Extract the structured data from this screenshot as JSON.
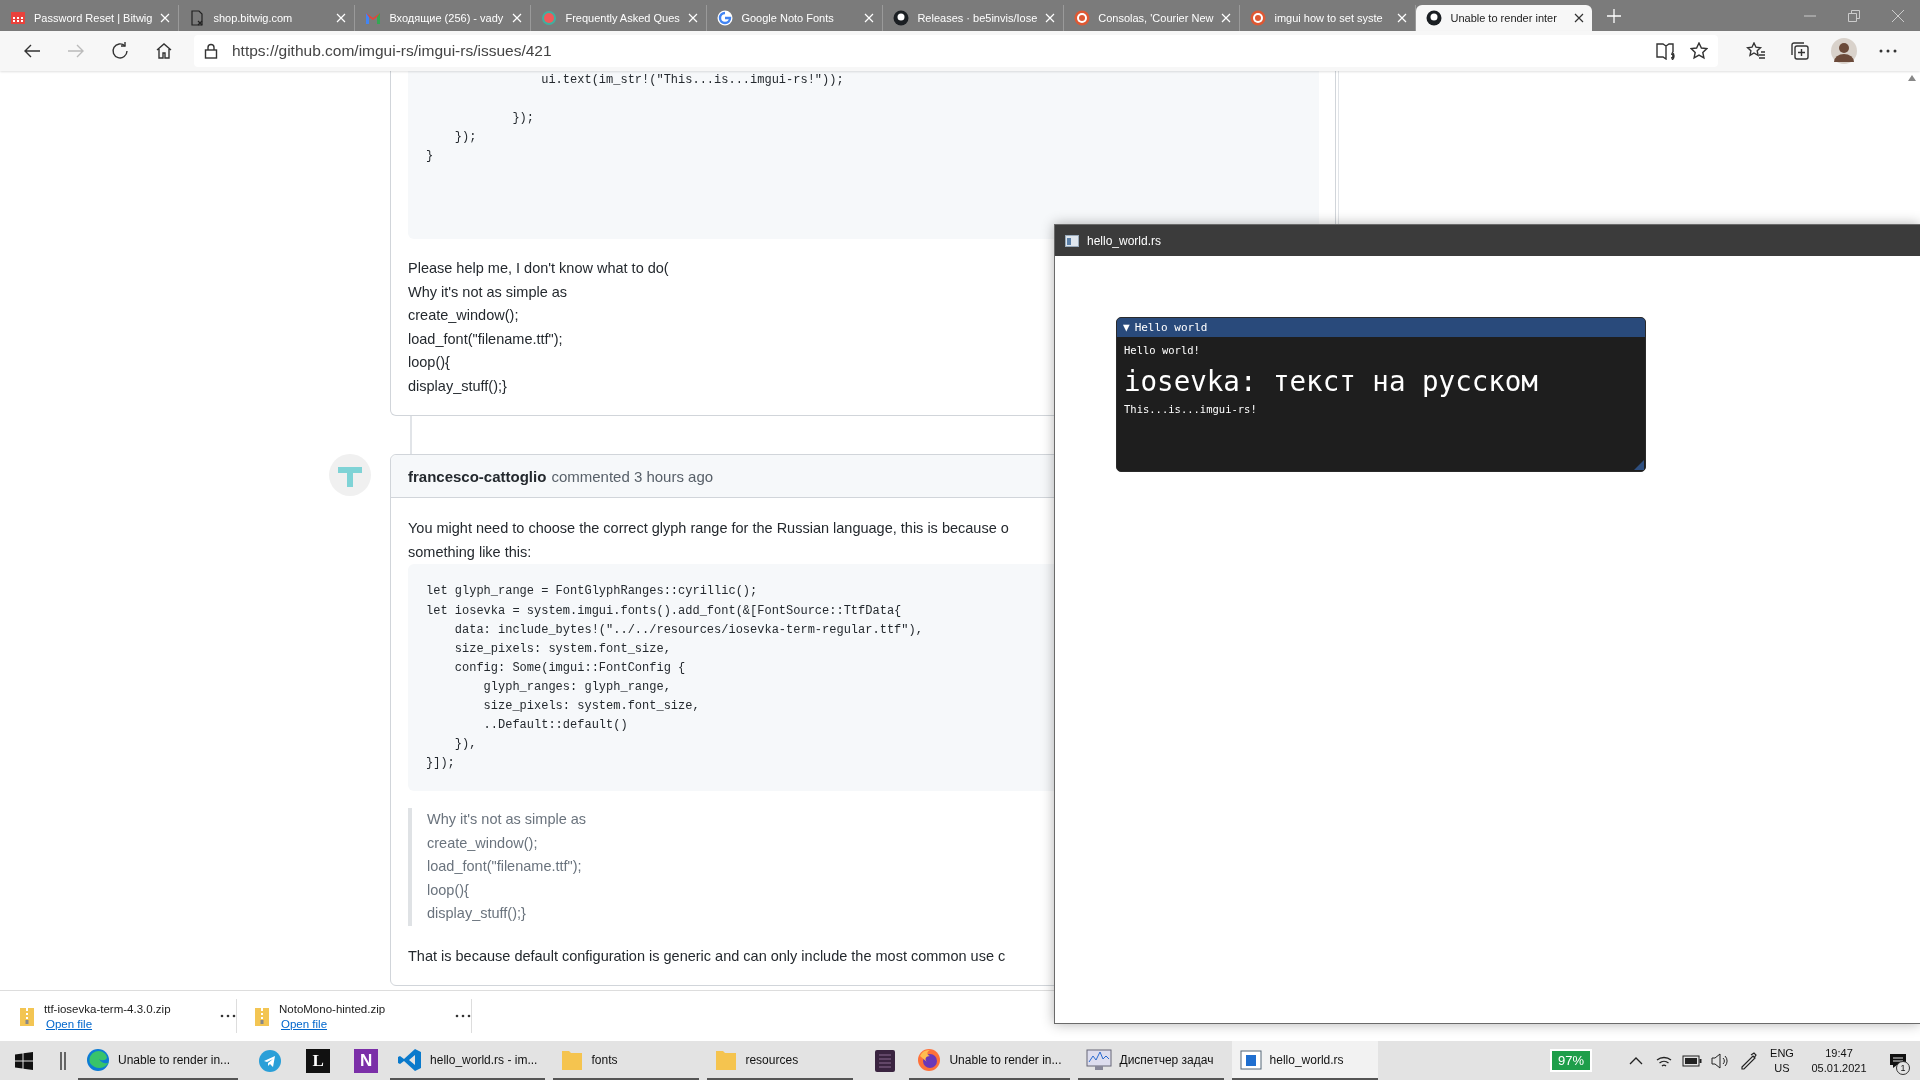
{
  "browser": {
    "tabs": [
      {
        "title": "Password Reset | Bitwig",
        "selected": false
      },
      {
        "title": "shop.bitwig.com",
        "selected": false
      },
      {
        "title": "Входящие (256) - vady",
        "selected": false
      },
      {
        "title": "Frequently Asked Ques",
        "selected": false
      },
      {
        "title": "Google Noto Fonts",
        "selected": false
      },
      {
        "title": "Releases · be5invis/Iose",
        "selected": false
      },
      {
        "title": "Consolas, 'Courier New",
        "selected": false
      },
      {
        "title": "imgui how to set syste",
        "selected": false
      },
      {
        "title": "Unable to render inter",
        "selected": true
      }
    ],
    "address": "https://github.com/imgui-rs/imgui-rs/issues/421"
  },
  "issue": {
    "comments": [
      {
        "blocks": [
          {
            "kind": "code",
            "text": "                ui.text(im_str!(\"This...is...imgui-rs!\"));\n\n            });\n    });\n}"
          },
          {
            "kind": "text",
            "text": "Please help me, I don't know what to do(\nWhy it's not as simple as\ncreate_window();\nload_font(\"filename.ttf\");\nloop(){\ndisplay_stuff();}"
          }
        ]
      },
      {
        "author": "francesco-cattoglio",
        "meta": "commented 3 hours ago",
        "blocks": [
          {
            "kind": "text",
            "text": "You might need to choose the correct glyph range for the Russian language, this is because o\nsomething like this:"
          },
          {
            "kind": "code",
            "text": "let glyph_range = FontGlyphRanges::cyrillic();\nlet iosevka = system.imgui.fonts().add_font(&[FontSource::TtfData{\n    data: include_bytes!(\"../../resources/iosevka-term-regular.ttf\"),\n    size_pixels: system.font_size,\n    config: Some(imgui::FontConfig {\n        glyph_ranges: glyph_range,\n        size_pixels: system.font_size,\n        ..Default::default()\n    }),\n}]);"
          },
          {
            "kind": "quote",
            "text": "Why it's not as simple as\ncreate_window();\nload_font(\"filename.ttf\");\nloop(){\ndisplay_stuff();}"
          },
          {
            "kind": "text",
            "text": "That is because default configuration is generic and can only include the most common use c"
          }
        ]
      }
    ]
  },
  "app_window": {
    "title": "hello_world.rs",
    "imgui": {
      "collapse": "▼",
      "title": "Hello world",
      "lines": [
        {
          "kind": "small",
          "text": "Hello world!"
        },
        {
          "kind": "large",
          "text": "iosevka: текст на русском"
        },
        {
          "kind": "small",
          "text": "This...is...imgui-rs!"
        }
      ]
    }
  },
  "downloads": [
    {
      "file": "ttf-iosevka-term-4.3.0.zip",
      "link": "Open file"
    },
    {
      "file": "NotoMono-hinted.zip",
      "link": "Open file"
    }
  ],
  "taskbar": {
    "items": [
      {
        "label": "Unable to render in...",
        "running": true,
        "selected": false
      },
      {
        "running": false,
        "selected": false
      },
      {
        "glyph": "L",
        "running": false,
        "selected": false
      },
      {
        "glyph": "N",
        "running": false,
        "selected": false
      },
      {
        "label": "hello_world.rs - im...",
        "running": true,
        "selected": false
      },
      {
        "label": "fonts",
        "running": true,
        "selected": false
      },
      {
        "label": "resources",
        "running": true,
        "selected": false
      },
      {
        "running": false,
        "selected": false
      },
      {
        "label": "Unable to render in...",
        "running": true,
        "selected": false
      },
      {
        "label": "Диспетчер задач",
        "running": true,
        "selected": false
      },
      {
        "label": "hello_world.rs",
        "running": true,
        "selected": true
      }
    ],
    "tray": {
      "battery": "97%",
      "language": "ENG",
      "region": "US",
      "time": "19:47",
      "date": "05.01.2021",
      "notifications": "1"
    }
  }
}
